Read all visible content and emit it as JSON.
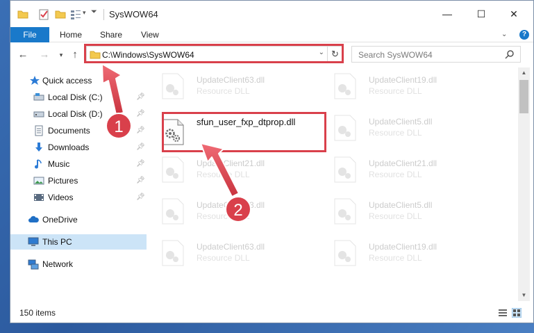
{
  "window": {
    "title": "SysWOW64",
    "controls": {
      "minimize": "—",
      "maximize": "☐",
      "close": "✕"
    }
  },
  "ribbon": {
    "tabs": [
      "File",
      "Home",
      "Share",
      "View"
    ],
    "expand_icon": "chevron-down",
    "help_label": "?"
  },
  "navigation": {
    "address": "C:\\Windows\\SysWOW64",
    "search_placeholder": "Search SysWOW64"
  },
  "sidebar": {
    "items": [
      {
        "label": "Quick access",
        "icon": "star-icon",
        "pinned": false
      },
      {
        "label": "Local Disk (C:)",
        "icon": "drive-icon",
        "pinned": true
      },
      {
        "label": "Local Disk (D:)",
        "icon": "drive-icon",
        "pinned": true
      },
      {
        "label": "Documents",
        "icon": "document-icon",
        "pinned": true
      },
      {
        "label": "Downloads",
        "icon": "download-icon",
        "pinned": true
      },
      {
        "label": "Music",
        "icon": "music-icon",
        "pinned": true
      },
      {
        "label": "Pictures",
        "icon": "picture-icon",
        "pinned": true
      },
      {
        "label": "Videos",
        "icon": "video-icon",
        "pinned": true
      },
      {
        "label": "OneDrive",
        "icon": "cloud-icon",
        "pinned": false
      },
      {
        "label": "This PC",
        "icon": "computer-icon",
        "pinned": false,
        "selected": true
      },
      {
        "label": "Network",
        "icon": "network-icon",
        "pinned": false
      }
    ]
  },
  "files": {
    "highlighted": {
      "name": "sfun_user_fxp_dtprop.dll"
    },
    "items": [
      {
        "name": "UpdateClient63.dll",
        "type": "Resource DLL"
      },
      {
        "name": "UpdateClient19.dll",
        "type": "Resource DLL"
      },
      {
        "name": "UpdateClient5.dll",
        "type": "Resource DLL"
      },
      {
        "name": "UpdateClient21.dll",
        "type": "Resource DLL"
      },
      {
        "name": "UpdateClient21.dll",
        "type": "Resource DLL"
      },
      {
        "name": "UpdateClient63.dll",
        "type": "Resource DLL"
      },
      {
        "name": "UpdateClient5.dll",
        "type": "Resource DLL"
      },
      {
        "name": "UpdateClient63.dll",
        "type": "Resource DLL"
      },
      {
        "name": "UpdateClient19.dll",
        "type": "Resource DLL"
      }
    ]
  },
  "status": {
    "item_count": "150 items"
  },
  "annotations": {
    "step1": "1",
    "step2": "2",
    "color": "#d9404b"
  }
}
